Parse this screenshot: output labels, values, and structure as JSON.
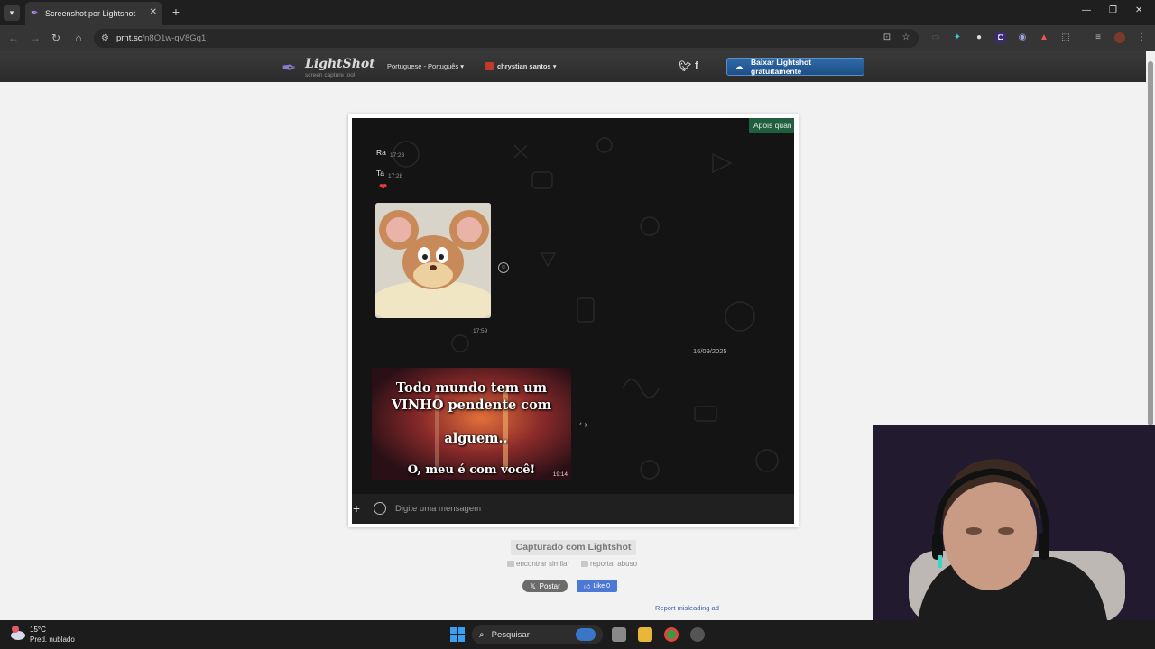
{
  "browser": {
    "tab_title": "Screenshot por Lightshot",
    "url_host": "prnt.sc",
    "url_path": "/n8O1w-qV8Gq1"
  },
  "lightshot": {
    "logo_name": "LightShot",
    "logo_tagline": "screen capture tool",
    "language": "Portuguese - Português ▾",
    "user": "chrystian santos ▾",
    "download_label": "Baixar Lightshot gratuitamente",
    "captured_label": "Capturado com Lightshot",
    "find_similar": "encontrar similar",
    "report_abuse": "reportar abuso",
    "x_post": "Postar",
    "fb_like": "Like 0",
    "report_ad": "Report misleading ad"
  },
  "chat": {
    "popup_text": "Apois quan",
    "messages": [
      {
        "text": "Ra",
        "time": "17:28"
      },
      {
        "text": "Ta",
        "time": "17:28"
      }
    ],
    "reaction": "❤",
    "sticker_time": "17:59",
    "date_separator": "16/09/2025",
    "gif_lines": [
      "Todo mundo tem um",
      "VINHO pendente com",
      "alguem..",
      "O, meu é com você!"
    ],
    "gif_time": "19:14",
    "composer_placeholder": "Digite uma mensagem"
  },
  "taskbar": {
    "weather_temp": "15°C",
    "weather_desc": "Pred. nublado",
    "search_label": "Pesquisar"
  }
}
